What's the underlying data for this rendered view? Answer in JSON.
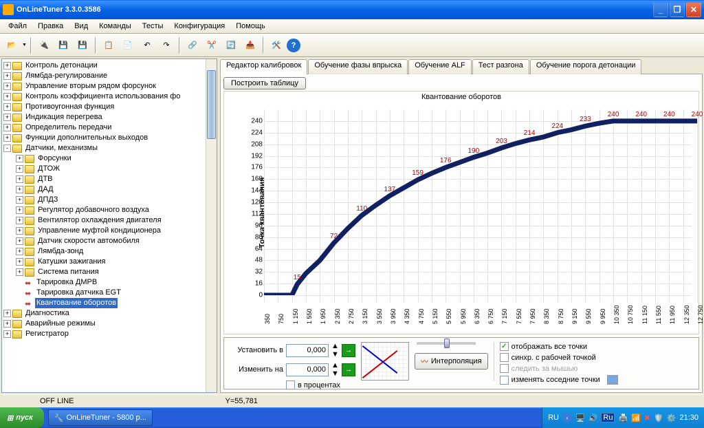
{
  "window": {
    "title": "OnLineTuner 3.3.0.3586"
  },
  "menu": [
    "Файл",
    "Правка",
    "Вид",
    "Команды",
    "Тесты",
    "Конфигурация",
    "Помощь"
  ],
  "tree": {
    "root": [
      {
        "l": "Контроль детонации",
        "e": "+"
      },
      {
        "l": "Лямбда-регулирование",
        "e": "+"
      },
      {
        "l": "Управление вторым рядом форсунок",
        "e": "+"
      },
      {
        "l": "Контроль коэффициента использования фо",
        "e": "+"
      },
      {
        "l": "Противоугонная функция",
        "e": "+"
      },
      {
        "l": "Индикация перегрева",
        "e": "+"
      },
      {
        "l": "Определитель передачи",
        "e": "+"
      },
      {
        "l": "Функции дополнительных выходов",
        "e": "+"
      },
      {
        "l": "Датчики, механизмы",
        "e": "-",
        "children": [
          {
            "l": "Форсунки",
            "e": "+",
            "d": 1
          },
          {
            "l": "ДТОЖ",
            "e": "+",
            "d": 1
          },
          {
            "l": "ДТВ",
            "e": "+",
            "d": 1
          },
          {
            "l": "ДАД",
            "e": "+",
            "d": 1
          },
          {
            "l": "ДПДЗ",
            "e": "+",
            "d": 1
          },
          {
            "l": "Регулятор добавочного воздуха",
            "e": "+",
            "d": 1
          },
          {
            "l": "Вентилятор охлаждения двигателя",
            "e": "+",
            "d": 1
          },
          {
            "l": "Управление муфтой кондиционера",
            "e": "+",
            "d": 1
          },
          {
            "l": "Датчик скорости автомобиля",
            "e": "+",
            "d": 1
          },
          {
            "l": "Лямбда-зонд",
            "e": "+",
            "d": 1
          },
          {
            "l": "Катушки зажигания",
            "e": "+",
            "d": 1
          },
          {
            "l": "Система питания",
            "e": "+",
            "d": 1
          },
          {
            "l": "Тарировка ДМРВ",
            "e": "",
            "d": 1,
            "leaf": true
          },
          {
            "l": "Тарировка датчика EGT",
            "e": "",
            "d": 1,
            "leaf": true
          },
          {
            "l": "Квантование оборотов",
            "e": "",
            "d": 1,
            "leaf": true,
            "sel": true
          }
        ]
      },
      {
        "l": "Диагностика",
        "e": "+"
      },
      {
        "l": "Аварийные режимы",
        "e": "+"
      },
      {
        "l": "Регистратор",
        "e": "+"
      }
    ]
  },
  "tabs": [
    "Редактор калибровок",
    "Обучение фазы впрыска",
    "Обучение ALF",
    "Тест разгона",
    "Обучение порога детонации"
  ],
  "active_tab": 0,
  "build_table_btn": "Построить таблицу",
  "bottom": {
    "set_label": "Установить в",
    "set_value": "0,000",
    "change_label": "Изменить на",
    "change_value": "0,000",
    "percent_label": "в процентах",
    "interp_btn": "Интерполяция",
    "checks": [
      {
        "l": "отображать все точки",
        "c": true
      },
      {
        "l": "синхр. с рабочей точкой",
        "c": false
      },
      {
        "l": "следить за мышью",
        "c": false,
        "disabled": true
      },
      {
        "l": "изменять соседние точки",
        "c": false
      }
    ]
  },
  "status": {
    "offline": "OFF LINE",
    "coord": "Y=55,781"
  },
  "taskbar": {
    "start": "пуск",
    "app": "OnLineTuner - 5800 p...",
    "lang": "RU",
    "langbox": "Ru",
    "time": "21:30"
  },
  "chart_data": {
    "type": "line",
    "title": "Квантование оборотов",
    "ylabel": "Точка квантования",
    "xlabel": "",
    "ylim": [
      0,
      256
    ],
    "yticks": [
      0,
      16,
      32,
      48,
      64,
      80,
      96,
      112,
      128,
      144,
      160,
      176,
      192,
      208,
      224,
      240
    ],
    "xticks": [
      "350",
      "750",
      "1 150",
      "1 550",
      "1 950",
      "2 350",
      "2 750",
      "3 150",
      "3 550",
      "3 950",
      "4 350",
      "4 750",
      "5 150",
      "5 550",
      "5 950",
      "6 350",
      "6 750",
      "7 150",
      "7 550",
      "7 950",
      "8 350",
      "8 750",
      "9 150",
      "9 550",
      "9 950",
      "10 350",
      "10 750",
      "11 150",
      "11 550",
      "11 950",
      "12 350",
      "12 750"
    ],
    "x": [
      350,
      750,
      1150,
      1300,
      1550,
      1950,
      2350,
      2750,
      3150,
      3550,
      3950,
      4350,
      4750,
      5150,
      5550,
      5950,
      6350,
      6750,
      7150,
      7550,
      7950,
      8350,
      8750,
      9150,
      9550,
      9950,
      10350,
      10750,
      11150,
      11550,
      11950,
      12350,
      12750
    ],
    "values": [
      0,
      0,
      0,
      15,
      30,
      48,
      72,
      92,
      110,
      124,
      137,
      148,
      159,
      168,
      176,
      183,
      190,
      196,
      203,
      209,
      214,
      218,
      224,
      228,
      233,
      237,
      240,
      240,
      240,
      240,
      240,
      240,
      240
    ],
    "labels": [
      {
        "x": 1300,
        "v": 15
      },
      {
        "x": 2350,
        "v": 72
      },
      {
        "x": 3150,
        "v": 110
      },
      {
        "x": 3950,
        "v": 137
      },
      {
        "x": 4750,
        "v": 159
      },
      {
        "x": 5550,
        "v": 176
      },
      {
        "x": 6350,
        "v": 190
      },
      {
        "x": 7150,
        "v": 203
      },
      {
        "x": 7950,
        "v": 214
      },
      {
        "x": 8750,
        "v": 224
      },
      {
        "x": 9550,
        "v": 233
      },
      {
        "x": 10350,
        "v": 240
      },
      {
        "x": 11150,
        "v": 240
      },
      {
        "x": 11950,
        "v": 240
      },
      {
        "x": 12750,
        "v": 240
      }
    ]
  }
}
